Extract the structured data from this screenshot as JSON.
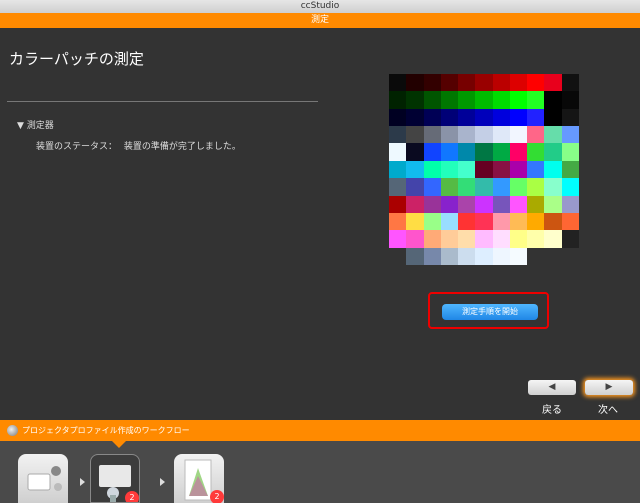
{
  "window": {
    "title": "ccStudio"
  },
  "topbar": {
    "title": "測定"
  },
  "page": {
    "title": "カラーパッチの測定",
    "section_label": "測定器",
    "status_label": "装置のステータス：",
    "status_value": "装置の準備が完了しました。"
  },
  "patches": [
    "#0a0a0a",
    "#220000",
    "#330000",
    "#550000",
    "#770000",
    "#990000",
    "#bb0000",
    "#dd0000",
    "#ff0000",
    "#e8001c",
    "#111111",
    "#002200",
    "#003300",
    "#005500",
    "#007700",
    "#009900",
    "#00bb00",
    "#00dd00",
    "#00ff00",
    "#22ff22",
    "#000000",
    "#080808",
    "#000022",
    "#000033",
    "#000055",
    "#000077",
    "#000099",
    "#0000bb",
    "#0000dd",
    "#0000ff",
    "#2222ff",
    "#000000",
    "#151515",
    "#2c3a4a",
    "#444444",
    "#666b77",
    "#8a93a8",
    "#a9b4cc",
    "#c4cfe6",
    "#dfe8f8",
    "#f2f6ff",
    "#ff6688",
    "#66ddaa",
    "#6699ff",
    "#eef9ff",
    "#0a0a20",
    "#1144ff",
    "#1177ff",
    "#0088aa",
    "#007744",
    "#00aa44",
    "#ff0066",
    "#33dd33",
    "#22cc88",
    "#88ff88",
    "#00aacc",
    "#11bbee",
    "#00ffaa",
    "#22ffbb",
    "#44ffcc",
    "#660022",
    "#881144",
    "#aa00aa",
    "#3377ff",
    "#00ffee",
    "#44aa44",
    "#556677",
    "#4444aa",
    "#3366ff",
    "#55bb44",
    "#33dd77",
    "#33bbaa",
    "#3399ff",
    "#66ff66",
    "#aaff44",
    "#88ffcc",
    "#00ffff",
    "#aa0000",
    "#cc2266",
    "#993399",
    "#8822cc",
    "#aa44aa",
    "#cc33ff",
    "#7755bb",
    "#ff55ff",
    "#aaaa00",
    "#aaff88",
    "#9999cc",
    "#ff7744",
    "#ffdd44",
    "#99ff88",
    "#99ddff",
    "#ff3333",
    "#ff3355",
    "#ff99aa",
    "#ffbb55",
    "#ffaa00",
    "#cc5511",
    "#ff6633",
    "#ff55ff",
    "#ff55cc",
    "#ffaa77",
    "#ffcc99",
    "#ffddaa",
    "#ffbbff",
    "#ffddff",
    "#ffff88",
    "#ffffaa",
    "#ffffcc",
    "#222222",
    "#333333",
    "#556677",
    "#7788aa",
    "#aabbcc",
    "#ccddee",
    "#ddeeff",
    "#eef6ff",
    "#f5fbff",
    "#333333",
    "#333333",
    "#333333"
  ],
  "actions": {
    "start_measure": "測定手順を開始"
  },
  "nav": {
    "back_label": "戻る",
    "next_label": "次へ",
    "back_arrow": "◀",
    "next_arrow": "▶"
  },
  "workflow": {
    "title": "プロジェクタプロファイル作成のワークフロー",
    "steps": [
      {
        "icon": "projector-settings-icon",
        "badge": ""
      },
      {
        "icon": "measure-device-icon",
        "badge": "2"
      },
      {
        "icon": "gamut-profile-icon",
        "badge": "2"
      }
    ]
  }
}
